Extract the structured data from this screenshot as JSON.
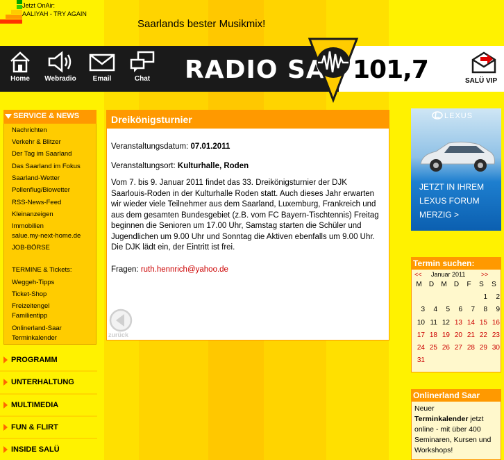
{
  "onair": {
    "label": "Jetzt OnAir:",
    "track": "AALIYAH - TRY AGAIN"
  },
  "slogan": "Saarlands bester Musikmix!",
  "header_nav": [
    {
      "label": "Home",
      "icon": "home-icon"
    },
    {
      "label": "Webradio",
      "icon": "speaker-icon"
    },
    {
      "label": "Email",
      "icon": "envelope-icon"
    },
    {
      "label": "Chat",
      "icon": "chat-icon"
    }
  ],
  "logo": {
    "name": "RADIO SALÜ",
    "frequency": "101,7"
  },
  "vip": {
    "label": "SALÜ VIP"
  },
  "sidebar": {
    "header": "SERVICE & NEWS",
    "links": [
      "Nachrichten",
      "Verkehr & Blitzer",
      "Der Tag im Saarland",
      "Das Saarland im Fokus",
      "Saarland-Wetter",
      "Pollenflug/Biowetter",
      "RSS-News-Feed",
      "Kleinanzeigen",
      "Immobilien",
      "salue.my-next-home.de",
      "JOB-BÖRSE"
    ],
    "section2_title": "TERMINE & Tickets:",
    "links2": [
      "Weggeh-Tipps",
      "Ticket-Shop",
      "Freizeitengel",
      "Familientipp",
      "Onlinerland-Saar",
      "Terminkalender"
    ]
  },
  "main_nav": [
    "PROGRAMM",
    "UNTERHALTUNG",
    "MULTIMEDIA",
    "FUN & FLIRT",
    "INSIDE SALÜ"
  ],
  "article": {
    "title": "Dreikönigsturnier",
    "date_label": "Veranstaltungsdatum: ",
    "date": "07.01.2011",
    "place_label": "Veranstaltungsort: ",
    "place": "Kulturhalle, Roden",
    "description": "Vom 7. bis 9. Januar 2011 findet das 33. Dreikönigsturnier der DJK Saarlouis-Roden in der Kulturhalle Roden statt. Auch dieses Jahr erwarten wir wieder viele Teilnehmer aus dem Saarland, Luxemburg, Frankreich und aus dem gesamten Bundesgebiet (z.B. vom FC Bayern-Tischtennis) Freitag beginnen die Senioren um 17.00 Uhr, Samstag starten die Schüler und Jugendlichen um 9.00 Uhr und Sonntag die Aktiven ebenfalls um 9.00 Uhr. Die DJK lädt ein, der Eintritt ist frei.",
    "questions_label": "Fragen: ",
    "email": "ruth.hennrich@yahoo.de",
    "back_label": "zurück"
  },
  "ad": {
    "brand": "LEXUS",
    "line1": "JETZT IN IHREM",
    "line2": "LEXUS FORUM",
    "line3": "MERZIG >"
  },
  "calendar": {
    "title": "Termin suchen:",
    "prev": "<<",
    "next": ">>",
    "month": "Januar 2011",
    "weekdays": [
      "M",
      "D",
      "M",
      "D",
      "F",
      "S",
      "S"
    ],
    "days": [
      "1",
      "2",
      "3",
      "4",
      "5",
      "6",
      "7",
      "8",
      "9",
      "10",
      "11",
      "12",
      "13",
      "14",
      "15",
      "16",
      "17",
      "18",
      "19",
      "20",
      "21",
      "22",
      "23",
      "24",
      "25",
      "26",
      "27",
      "28",
      "29",
      "30",
      "31"
    ],
    "red_from": 13
  },
  "onlinerland": {
    "title": "Onlinerland Saar",
    "line1": "Neuer",
    "bold": "Terminkalender",
    "line1_rest": " jetzt online - mit über 400 Seminaren, Kursen und Workshops!"
  },
  "colors": {
    "orange": "#ff9900",
    "dark": "#1a1a1a",
    "red_link": "#cc0000"
  }
}
